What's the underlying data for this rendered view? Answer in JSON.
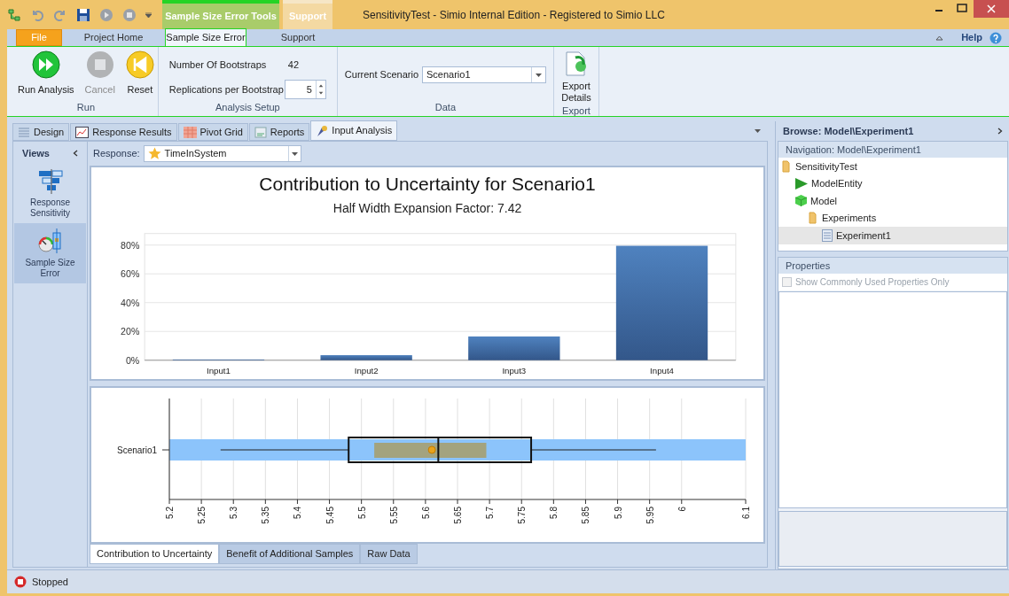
{
  "title_bar": {
    "contextual_tabs": [
      {
        "label": "Sample Size Error Tools",
        "kind": "active"
      },
      {
        "label": "Support",
        "kind": "faded"
      }
    ],
    "title": "SensitivityTest - Simio Internal Edition - Registered to Simio LLC"
  },
  "ribbon": {
    "tabs": [
      {
        "label": "File",
        "selected": false,
        "kind": "file"
      },
      {
        "label": "Project Home",
        "selected": false,
        "kind": "tab"
      },
      {
        "label": "Sample Size Error",
        "selected": true,
        "kind": "tab"
      },
      {
        "label": "Support",
        "selected": false,
        "kind": "tab"
      }
    ],
    "help": "Help",
    "groups": [
      {
        "name": "Run",
        "kind": "buttons",
        "buttons": [
          {
            "label": "Run Analysis",
            "disabled": false,
            "kind": "run"
          },
          {
            "label": "Cancel",
            "disabled": true,
            "kind": "cancel"
          },
          {
            "label": "Reset",
            "disabled": false,
            "kind": "reset"
          }
        ]
      },
      {
        "name": "Analysis Setup",
        "kind": "setup",
        "fields": [
          {
            "label": "Number Of Bootstraps",
            "value": "42",
            "kind": "readonly"
          },
          {
            "label": "Replications per Bootstrap",
            "value": "5",
            "kind": "spinner"
          }
        ]
      },
      {
        "name": "Data",
        "kind": "data",
        "label": "Current Scenario",
        "value": "Scenario1"
      },
      {
        "name": "Export",
        "kind": "export",
        "button": "Export Details"
      }
    ]
  },
  "document_tabs": [
    {
      "label": "Design",
      "selected": false,
      "kind": "design"
    },
    {
      "label": "Response Results",
      "selected": false,
      "kind": "results"
    },
    {
      "label": "Pivot Grid",
      "selected": false,
      "kind": "pivot"
    },
    {
      "label": "Reports",
      "selected": false,
      "kind": "reports"
    },
    {
      "label": "Input Analysis",
      "selected": true,
      "kind": "input"
    }
  ],
  "views": {
    "title": "Views",
    "items": [
      {
        "label": "Response Sensitivity",
        "selected": false,
        "kind": "sensitivity"
      },
      {
        "label": "Sample Size Error",
        "selected": true,
        "kind": "error"
      }
    ]
  },
  "response": {
    "label": "Response:",
    "value": "TimeInSystem"
  },
  "contribution_chart": {
    "title": "Contribution to Uncertainty for Scenario1",
    "subtitle": "Half Width Expansion Factor: 7.42",
    "chart_data": {
      "type": "bar",
      "categories": [
        "Input1",
        "Input2",
        "Input3",
        "Input4"
      ],
      "values": [
        0.5,
        3.5,
        16.5,
        79.5
      ],
      "ylim": [
        0,
        88
      ],
      "grid": true,
      "yticks": [
        {
          "value": 0,
          "label": "0%"
        },
        {
          "value": 20,
          "label": "20%"
        },
        {
          "value": 40,
          "label": "40%"
        },
        {
          "value": 60,
          "label": "60%"
        },
        {
          "value": 80,
          "label": "80%"
        }
      ]
    }
  },
  "box_plot": {
    "category": "Scenario1",
    "axis_labels": [
      "5.2",
      "5.25",
      "5.3",
      "5.35",
      "5.4",
      "5.45",
      "5.5",
      "5.55",
      "5.6",
      "5.65",
      "5.7",
      "5.75",
      "5.8",
      "5.85",
      "5.9",
      "5.95",
      "6",
      "6.1"
    ]
  },
  "bottom_tabs": [
    {
      "label": "Contribution to Uncertainty",
      "selected": true
    },
    {
      "label": "Benefit of Additional Samples",
      "selected": false
    },
    {
      "label": "Raw Data",
      "selected": false
    }
  ],
  "browse": {
    "title": "Browse: Model\\Experiment1",
    "navigation": "Navigation: Model\\Experiment1",
    "tree": [
      {
        "label": "SensitivityTest",
        "kind": "folder",
        "selected": false,
        "children": [
          {
            "label": "ModelEntity",
            "kind": "entity",
            "selected": false
          },
          {
            "label": "Model",
            "kind": "model",
            "selected": false,
            "children": [
              {
                "label": "Experiments",
                "kind": "folder",
                "selected": false,
                "children": [
                  {
                    "label": "Experiment1",
                    "kind": "experiment",
                    "selected": true
                  }
                ]
              }
            ]
          }
        ]
      }
    ],
    "properties": "Properties",
    "checkbox": {
      "label": "Show Commonly Used Properties Only",
      "checked": false,
      "disabled": true
    }
  },
  "status_bar": {
    "text": "Stopped"
  }
}
